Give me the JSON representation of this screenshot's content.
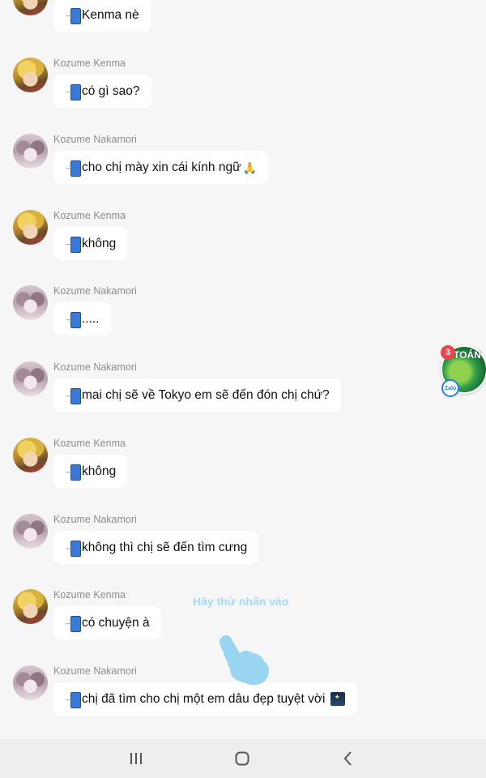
{
  "messages": [
    {
      "sender": "",
      "avatar": "kenma",
      "text": "Kenma nè",
      "icon": "phone-arrow"
    },
    {
      "sender": "Kozume Kenma",
      "avatar": "kenma",
      "text": "có gì sao?",
      "icon": "phone-arrow"
    },
    {
      "sender": "Kozume Nakamori",
      "avatar": "naka",
      "text": "cho chị mày xin cái kính ngữ",
      "icon": "phone-arrow",
      "trailing_emoji": "🙏"
    },
    {
      "sender": "Kozume Kenma",
      "avatar": "kenma",
      "text": "không",
      "icon": "phone-arrow"
    },
    {
      "sender": "Kozume Nakamori",
      "avatar": "naka",
      "text": ".....",
      "icon": "phone-arrow"
    },
    {
      "sender": "Kozume Nakamori",
      "avatar": "naka",
      "text": "mai chị sẽ về Tokyo em sẽ đến đón chị chứ?",
      "icon": "phone-arrow"
    },
    {
      "sender": "Kozume Kenma",
      "avatar": "kenma",
      "text": "không",
      "icon": "phone-arrow"
    },
    {
      "sender": "Kozume Nakamori",
      "avatar": "naka",
      "text": "không thì chị sẽ đến tìm cưng",
      "icon": "phone-arrow"
    },
    {
      "sender": "Kozume Kenma",
      "avatar": "kenma",
      "text": " có chuyện à",
      "icon": "phone-arrow"
    },
    {
      "sender": "Kozume Nakamori",
      "avatar": "naka",
      "text": "chị đã tìm cho chị một em dâu đẹp tuyệt vời",
      "icon": "phone-arrow",
      "trailing_emoji": "night-sky"
    }
  ],
  "floating_widget": {
    "badge_count": "3",
    "title": "TOÁN",
    "app_label": "Zalo"
  },
  "hint": {
    "text": "Hãy thử nhấn vào",
    "icon": "pointing-hand-icon"
  },
  "navbar": {
    "buttons": [
      "recent-apps-icon",
      "home-icon",
      "back-icon"
    ]
  },
  "colors": {
    "background": "#f6f6f7",
    "bubble": "#ffffff",
    "sender_text": "#8a8d91",
    "hint_text": "#a9d8f2",
    "badge": "#e5484d"
  }
}
